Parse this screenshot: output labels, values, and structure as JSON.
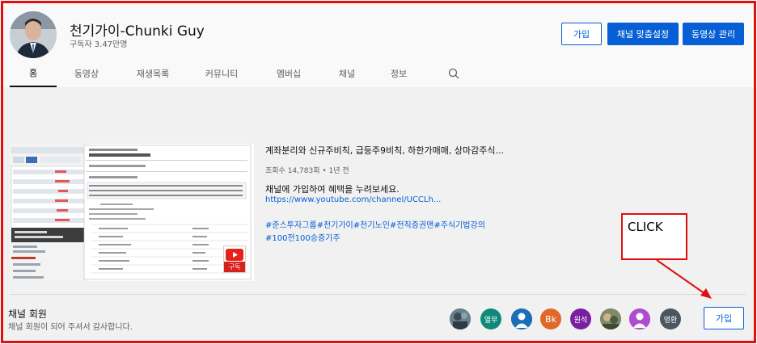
{
  "channel": {
    "title": "천기가이-Chunki Guy",
    "subscribers": "구독자 3.47만명"
  },
  "header_buttons": {
    "join": "가입",
    "customize": "채널 맞춤설정",
    "manage": "동영상 관리"
  },
  "tabs": [
    {
      "label": "홈",
      "active": true
    },
    {
      "label": "동영상"
    },
    {
      "label": "재생목록"
    },
    {
      "label": "커뮤니티"
    },
    {
      "label": "멤버십"
    },
    {
      "label": "채널"
    },
    {
      "label": "정보"
    }
  ],
  "search_icon": "search-icon",
  "featured_video": {
    "title": "계좌분리와 신규주비칙, 급등주9비칙, 하한가매매, 상마감주식...",
    "meta": "조회수 14,783회 • 1년 전",
    "description": "채널에 가입하여 혜택을 누려보세요.",
    "link_url": "https://www.youtube.com/channel/UCCLh...",
    "hashtags_line1": "#준스투자그룹#천기가이#천기노인#전직증권맨#주식기법강의",
    "hashtags_line2": "#100전100승증기주",
    "subscribe_badge": "구독"
  },
  "members": {
    "title": "채널 회원",
    "subtitle": "채널 회원이 되어 주셔서 감사합니다.",
    "join_button": "가입",
    "avatars": [
      {
        "label": "",
        "color": "#5a6f7c"
      },
      {
        "label": "열무",
        "color": "#0f8a7a"
      },
      {
        "label": "",
        "color": "#1a6fb8"
      },
      {
        "label": "Bk",
        "color": "#e0682a"
      },
      {
        "label": "원석",
        "color": "#7b1fa2"
      },
      {
        "label": "",
        "color": "#6d7a5a"
      },
      {
        "label": "",
        "color": "#b04ccf"
      },
      {
        "label": "영환",
        "color": "#4b5660"
      }
    ]
  },
  "annotation": {
    "text": "CLICK",
    "color": "#e01010"
  }
}
